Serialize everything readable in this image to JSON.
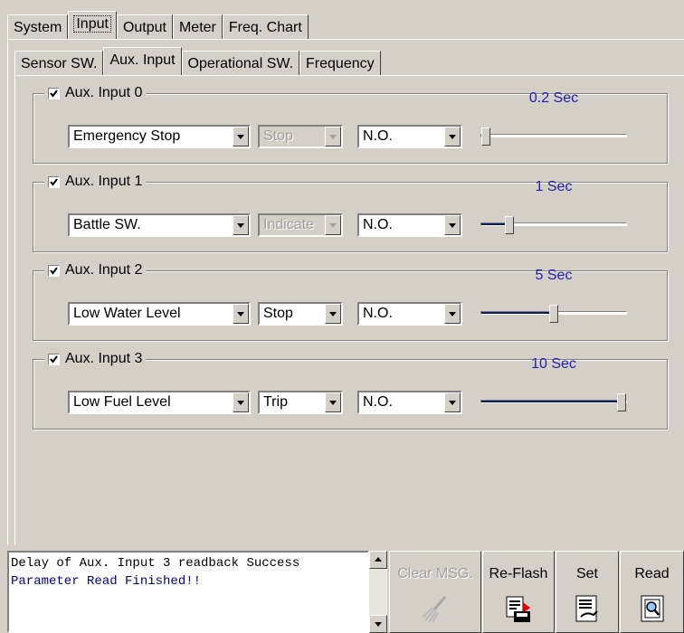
{
  "main_tabs": [
    "System",
    "Input",
    "Output",
    "Meter",
    "Freq. Chart"
  ],
  "selected_main_tab": "Input",
  "sub_tabs": [
    "Sensor SW.",
    "Aux. Input",
    "Operational SW.",
    "Frequency"
  ],
  "selected_sub_tab": "Aux. Input",
  "aux_inputs": [
    {
      "label": "Aux. Input 0",
      "checked": true,
      "function": "Emergency Stop",
      "action": "Stop",
      "action_enabled": false,
      "contact": "N.O.",
      "delay_text": "0.2 Sec",
      "delay_level": 0.0
    },
    {
      "label": "Aux. Input 1",
      "checked": true,
      "function": "Battle SW.",
      "action": "Indicate",
      "action_enabled": false,
      "contact": "N.O.",
      "delay_text": "1 Sec",
      "delay_level": 0.17
    },
    {
      "label": "Aux. Input 2",
      "checked": true,
      "function": "Low Water Level",
      "action": "Stop",
      "action_enabled": true,
      "contact": "N.O.",
      "delay_text": "5 Sec",
      "delay_level": 0.5
    },
    {
      "label": "Aux. Input 3",
      "checked": true,
      "function": "Low Fuel Level",
      "action": "Trip",
      "action_enabled": true,
      "contact": "N.O.",
      "delay_text": "10 Sec",
      "delay_level": 1.0
    }
  ],
  "messages": [
    "Delay of Aux. Input 3 readback Success",
    "Parameter Read Finished!!"
  ],
  "buttons": {
    "clear_msg": "Clear MSG.",
    "reflash": "Re-Flash",
    "set": "Set",
    "read": "Read"
  },
  "colors": {
    "slider_value_text": "#2020b0",
    "slider_fill": "#0a1a6a",
    "message_line2": "#00008b"
  }
}
